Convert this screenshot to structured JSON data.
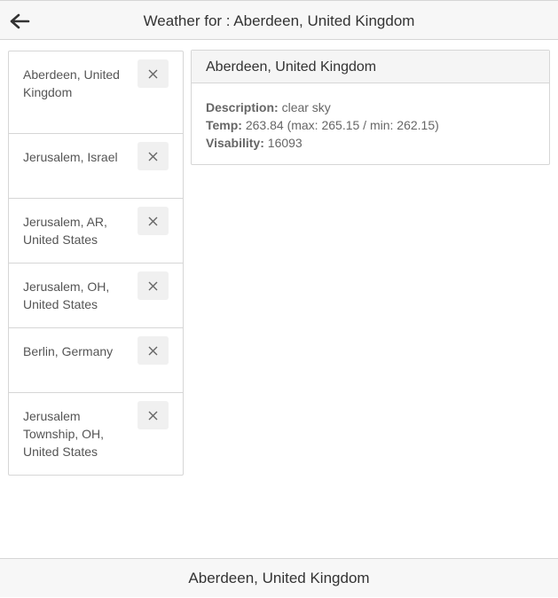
{
  "header": {
    "title": "Weather for : Aberdeen, United Kingdom",
    "back_icon": "arrow-left-icon"
  },
  "cities": [
    {
      "label": "Aberdeen, United Kingdom"
    },
    {
      "label": "Jerusalem, Israel"
    },
    {
      "label": "Jerusalem, AR, United States"
    },
    {
      "label": "Jerusalem, OH, United States"
    },
    {
      "label": "Berlin, Germany"
    },
    {
      "label": "Jerusalem Township, OH, United States"
    }
  ],
  "remove_icon": "close-icon",
  "detail": {
    "title": "Aberdeen, United Kingdom",
    "description_label": "Description:",
    "description_value": " clear sky",
    "temp_label": "Temp:",
    "temp_value": " 263.84 (max: 265.15 / min: 262.15)",
    "visibility_label": "Visability:",
    "visibility_value": " 16093"
  },
  "footer": {
    "label": "Aberdeen, United Kingdom"
  }
}
